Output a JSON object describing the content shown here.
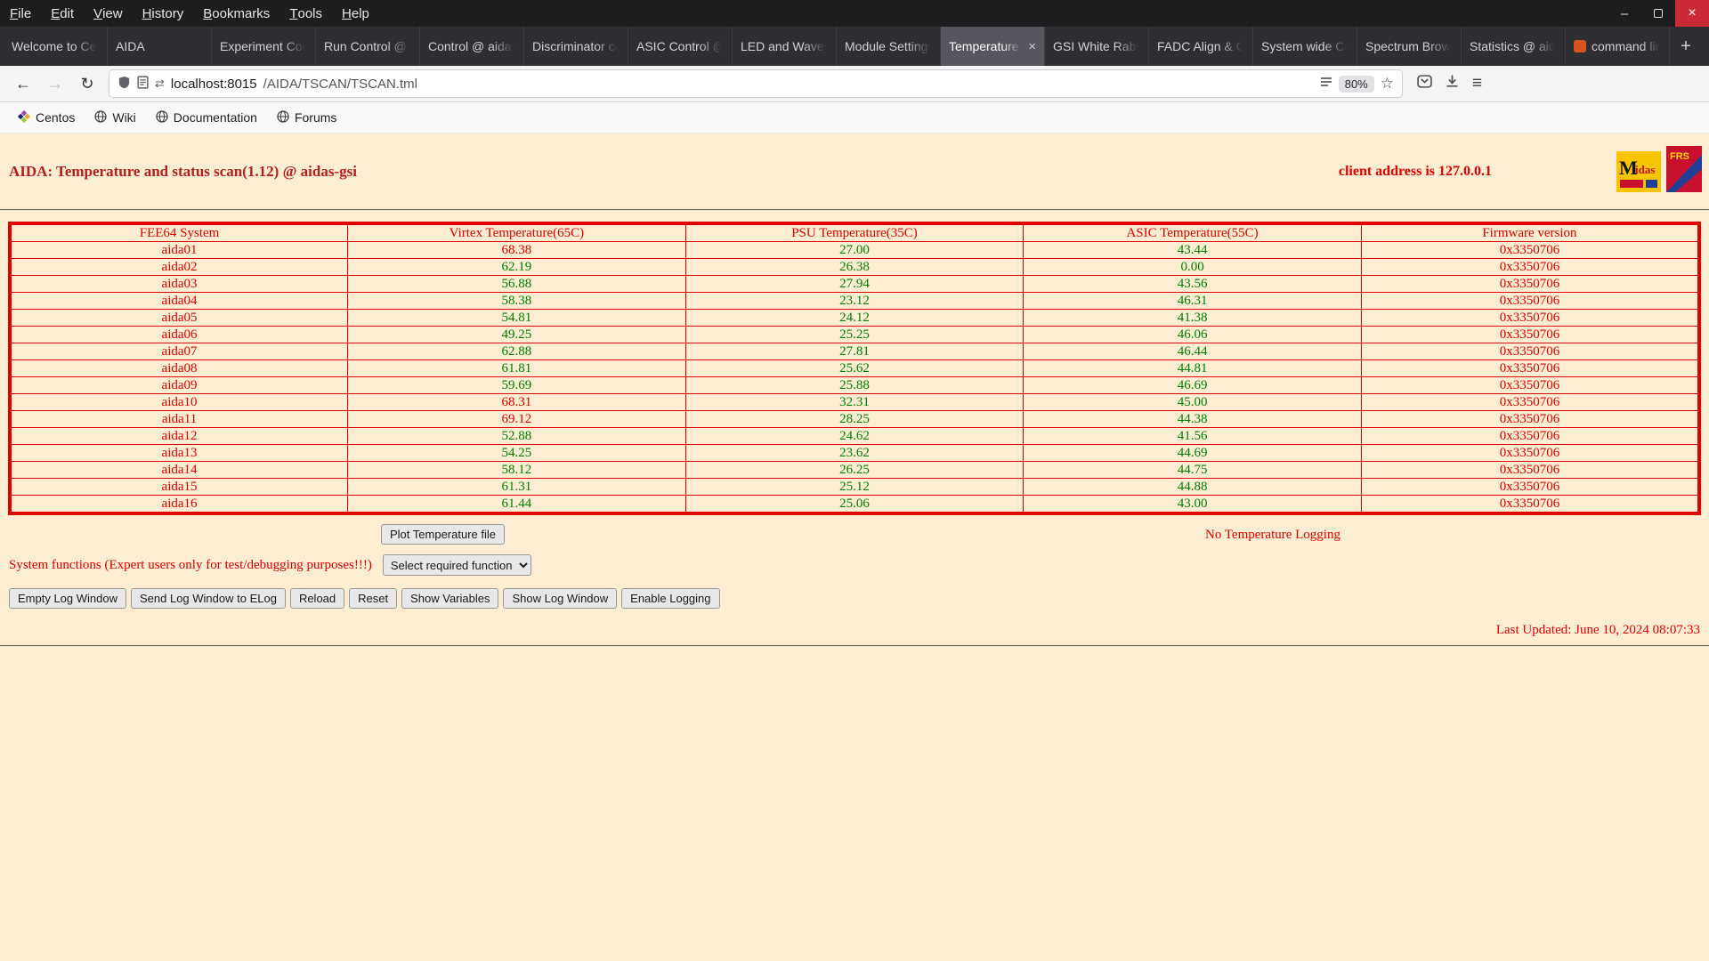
{
  "window": {
    "menu_items": [
      "File",
      "Edit",
      "View",
      "History",
      "Bookmarks",
      "Tools",
      "Help"
    ]
  },
  "icons": {
    "minimize": "–",
    "close": "×",
    "tab_close": "×",
    "new_tab": "+",
    "back": "←",
    "forward": "→",
    "reload": "↻",
    "permissions": "⇄",
    "star": "☆",
    "menu": "≡"
  },
  "tabs": {
    "items": [
      {
        "label": "Welcome to Cen"
      },
      {
        "label": "AIDA"
      },
      {
        "label": "Experiment Con"
      },
      {
        "label": "Run Control @ a"
      },
      {
        "label": "Control @ aidas"
      },
      {
        "label": "Discriminator co"
      },
      {
        "label": "ASIC Control @"
      },
      {
        "label": "LED and Wavefo"
      },
      {
        "label": "Module Settings"
      },
      {
        "label": "Temperature sc",
        "active": true
      },
      {
        "label": "GSI White Rabb"
      },
      {
        "label": "FADC Align & C"
      },
      {
        "label": "System wide Co"
      },
      {
        "label": "Spectrum Brow"
      },
      {
        "label": "Statistics @ aid"
      },
      {
        "label": "command line",
        "favicon_color": "#d9531e"
      }
    ]
  },
  "navbar": {
    "url_host": "localhost:8015",
    "url_path": "/AIDA/TSCAN/TSCAN.tml",
    "zoom_badge": "80%"
  },
  "bookmarks": {
    "items": [
      {
        "label": "Centos"
      },
      {
        "label": "Wiki"
      },
      {
        "label": "Documentation"
      },
      {
        "label": "Forums"
      }
    ]
  },
  "page": {
    "title": "AIDA: Temperature and status scan(1.12) @ aidas-gsi",
    "client_address": "client address is 127.0.0.1",
    "colors": {
      "red": "#e00000",
      "green": "#008000",
      "title": "#b42020",
      "page_bg": "#fcedd3"
    },
    "table": {
      "headers": [
        "FEE64 System",
        "Virtex Temperature(65C)",
        "PSU Temperature(35C)",
        "ASIC Temperature(55C)",
        "Firmware version"
      ],
      "rows": [
        {
          "name": "aida01",
          "virtex": "68.38",
          "virtex_alarm": true,
          "psu": "27.00",
          "asic": "43.44",
          "firmware": "0x3350706"
        },
        {
          "name": "aida02",
          "virtex": "62.19",
          "psu": "26.38",
          "asic": "0.00",
          "firmware": "0x3350706"
        },
        {
          "name": "aida03",
          "virtex": "56.88",
          "psu": "27.94",
          "asic": "43.56",
          "firmware": "0x3350706"
        },
        {
          "name": "aida04",
          "virtex": "58.38",
          "psu": "23.12",
          "asic": "46.31",
          "firmware": "0x3350706"
        },
        {
          "name": "aida05",
          "virtex": "54.81",
          "psu": "24.12",
          "asic": "41.38",
          "firmware": "0x3350706"
        },
        {
          "name": "aida06",
          "virtex": "49.25",
          "psu": "25.25",
          "asic": "46.06",
          "firmware": "0x3350706"
        },
        {
          "name": "aida07",
          "virtex": "62.88",
          "psu": "27.81",
          "asic": "46.44",
          "firmware": "0x3350706"
        },
        {
          "name": "aida08",
          "virtex": "61.81",
          "psu": "25.62",
          "asic": "44.81",
          "firmware": "0x3350706"
        },
        {
          "name": "aida09",
          "virtex": "59.69",
          "psu": "25.88",
          "asic": "46.69",
          "firmware": "0x3350706"
        },
        {
          "name": "aida10",
          "virtex": "68.31",
          "virtex_alarm": true,
          "psu": "32.31",
          "asic": "45.00",
          "firmware": "0x3350706"
        },
        {
          "name": "aida11",
          "virtex": "69.12",
          "virtex_alarm": true,
          "psu": "28.25",
          "asic": "44.38",
          "firmware": "0x3350706"
        },
        {
          "name": "aida12",
          "virtex": "52.88",
          "psu": "24.62",
          "asic": "41.56",
          "firmware": "0x3350706"
        },
        {
          "name": "aida13",
          "virtex": "54.25",
          "psu": "23.62",
          "asic": "44.69",
          "firmware": "0x3350706"
        },
        {
          "name": "aida14",
          "virtex": "58.12",
          "psu": "26.25",
          "asic": "44.75",
          "firmware": "0x3350706"
        },
        {
          "name": "aida15",
          "virtex": "61.31",
          "psu": "25.12",
          "asic": "44.88",
          "firmware": "0x3350706"
        },
        {
          "name": "aida16",
          "virtex": "61.44",
          "psu": "25.06",
          "asic": "43.00",
          "firmware": "0x3350706"
        }
      ]
    },
    "plot_button_label": "Plot Temperature file",
    "logging_status": "No Temperature Logging",
    "system_functions_label": "System functions (Expert users only for test/debugging purposes!!!)",
    "function_select_value": "Select required function",
    "action_buttons": [
      "Empty Log Window",
      "Send Log Window to ELog",
      "Reload",
      "Reset",
      "Show Variables",
      "Show Log Window",
      "Enable Logging"
    ],
    "last_updated": "Last Updated: June 10, 2024 08:07:33"
  }
}
